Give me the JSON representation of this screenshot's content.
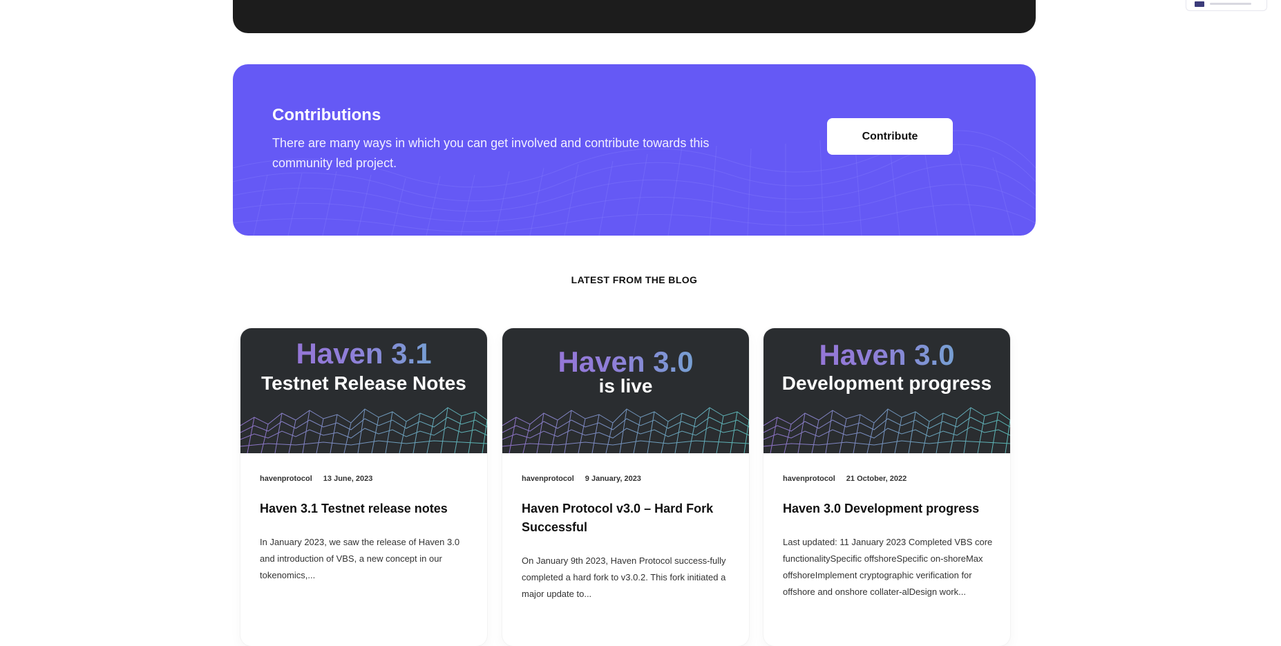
{
  "contributions": {
    "title": "Contributions",
    "text": "There are many ways in which you can get involved and contribute towards this community led project.",
    "button_label": "Contribute"
  },
  "blog": {
    "heading": "LATEST FROM THE BLOG",
    "posts": [
      {
        "banner_title": "Haven 3.1",
        "banner_sub": "Testnet Release Notes",
        "author": "havenprotocol",
        "date": "13 June, 2023",
        "title": "Haven 3.1 Testnet release notes",
        "excerpt": "In January 2023, we saw the release of Haven 3.0 and introduction of VBS, a new concept in our tokenomics,..."
      },
      {
        "banner_title": "Haven 3.0",
        "banner_sub": "is live",
        "author": "havenprotocol",
        "date": "9 January, 2023",
        "title": "Haven Protocol v3.0 – Hard Fork Successful",
        "excerpt": "On January 9th 2023, Haven Protocol success-fully completed a hard fork to v3.0.2. This fork initiated a major update to..."
      },
      {
        "banner_title": "Haven 3.0",
        "banner_sub": "Development progress",
        "author": "havenprotocol",
        "date": "21 October, 2022",
        "title": "Haven 3.0 Development progress",
        "excerpt": "Last updated: 11 January 2023 Completed VBS core functionalitySpecific offshoreSpecific on-shoreMax offshoreImplement cryptographic verification for offshore and onshore collater-alDesign work..."
      }
    ]
  },
  "colors": {
    "accent": "#6559f5",
    "card_banner": "#2a2d30",
    "dark_block": "#1c1c1c"
  }
}
